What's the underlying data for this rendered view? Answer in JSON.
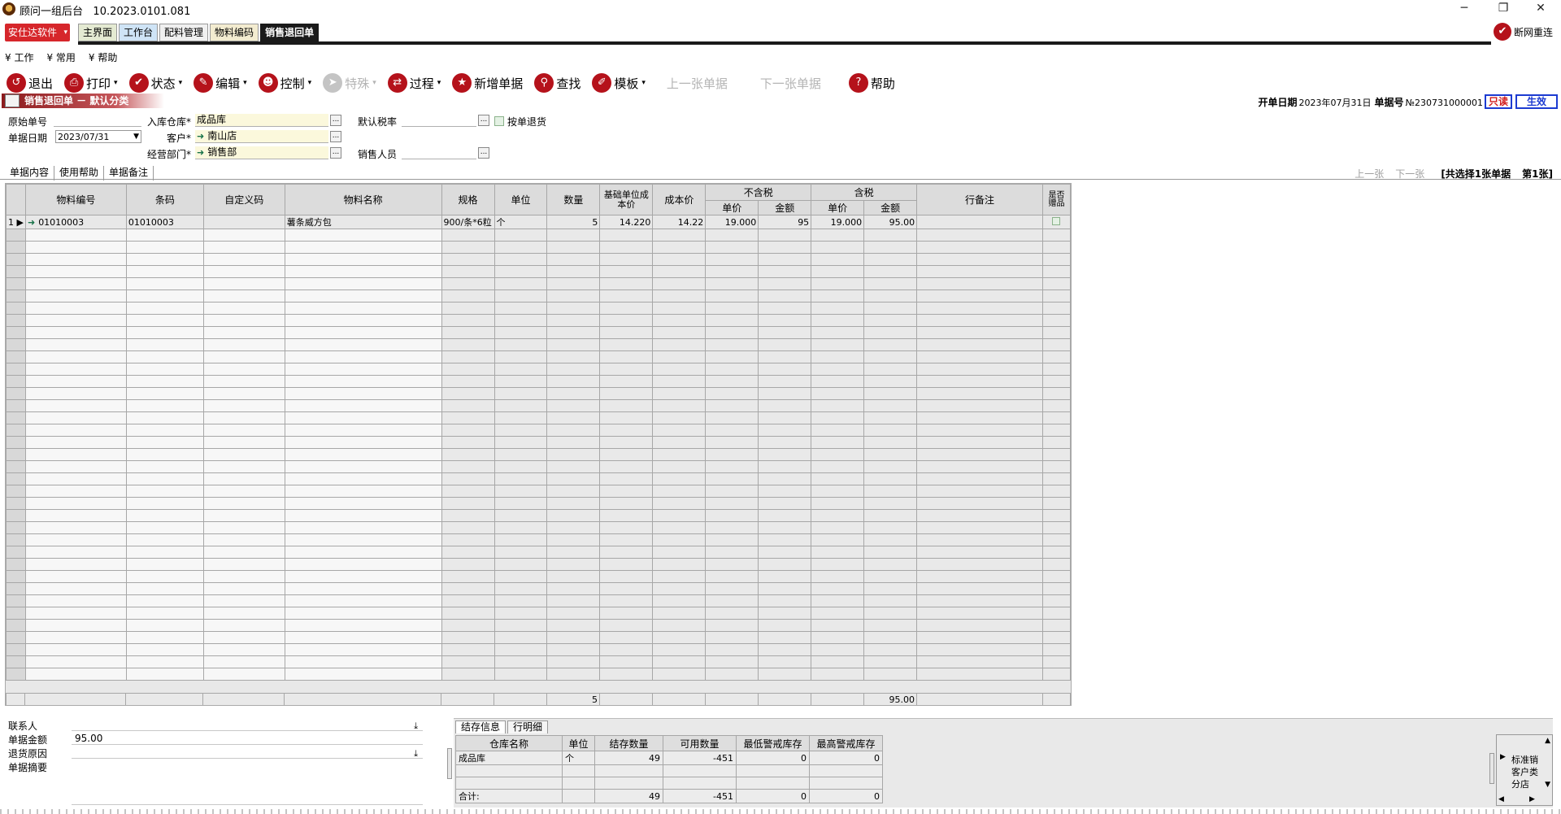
{
  "window": {
    "title": "顾问一组后台",
    "version": "10.2023.0101.081",
    "minimize": "─",
    "restore": "❐",
    "close": "✕"
  },
  "brand": {
    "label": "安仕达软件",
    "caret": "▾"
  },
  "nav_tabs": [
    "主界面",
    "工作台",
    "配料管理",
    "物料编码",
    "销售退回单"
  ],
  "offline": {
    "label": "断网重连"
  },
  "menu": [
    "¥ 工作",
    "¥ 常用",
    "¥ 帮助"
  ],
  "toolbar": [
    {
      "label": "退出",
      "icon": "exit-icon",
      "dropdown": false,
      "disabled": false
    },
    {
      "label": "打印",
      "icon": "print-icon",
      "dropdown": true,
      "disabled": false
    },
    {
      "label": "状态",
      "icon": "check-icon",
      "dropdown": true,
      "disabled": false
    },
    {
      "label": "编辑",
      "icon": "edit-icon",
      "dropdown": true,
      "disabled": false
    },
    {
      "label": "控制",
      "icon": "user-icon",
      "dropdown": true,
      "disabled": false
    },
    {
      "label": "特殊",
      "icon": "send-icon",
      "dropdown": true,
      "disabled": true
    },
    {
      "label": "过程",
      "icon": "process-icon",
      "dropdown": true,
      "disabled": false
    },
    {
      "label": "新增单据",
      "icon": "star-icon",
      "dropdown": false,
      "disabled": false
    },
    {
      "label": "查找",
      "icon": "search-icon",
      "dropdown": false,
      "disabled": false
    },
    {
      "label": "模板",
      "icon": "template-icon",
      "dropdown": true,
      "disabled": false
    },
    {
      "label": "上一张单据",
      "icon": "",
      "dropdown": false,
      "disabled": true
    },
    {
      "label": "下一张单据",
      "icon": "",
      "dropdown": false,
      "disabled": true
    },
    {
      "label": "帮助",
      "icon": "help-icon",
      "dropdown": false,
      "disabled": false
    }
  ],
  "form": {
    "title": "销售退回单 － 默认分类",
    "open_date_label": "开单日期",
    "open_date": "2023年07月31日",
    "doc_no_label": "单据号",
    "doc_no": "№230731000001",
    "badge_readonly": "只读",
    "badge_effective": "生效",
    "fields": {
      "orig_doc_label": "原始单号",
      "orig_doc_value": "",
      "doc_date_label": "单据日期",
      "doc_date_value": "2023/07/31",
      "warehouse_label": "入库仓库*",
      "warehouse_value": "成品库",
      "customer_label": "客户*",
      "customer_value": "南山店",
      "dept_label": "经营部门*",
      "dept_value": "销售部",
      "tax_label": "默认税率",
      "tax_value": "",
      "by_doc_return_label": "按单退货",
      "sales_person_label": "销售人员",
      "sales_person_value": ""
    }
  },
  "sub_tabs": [
    "单据内容",
    "使用帮助",
    "单据备注"
  ],
  "pager": {
    "prev": "上一张",
    "next": "下一张",
    "summary": "[共选择1张单据",
    "current": "第1张]"
  },
  "grid": {
    "headers": {
      "item_code": "物料编号",
      "barcode": "条码",
      "custom_code": "自定义码",
      "item_name": "物料名称",
      "spec": "规格",
      "unit": "单位",
      "qty": "数量",
      "base_cost": "基础单位成本价",
      "cost": "成本价",
      "no_tax": "不含税",
      "no_tax_price": "单价",
      "no_tax_amount": "金额",
      "tax": "含税",
      "tax_price": "单价",
      "tax_amount": "金额",
      "note": "行备注",
      "gift": "是否赠品"
    },
    "rows": [
      {
        "row_no": "1",
        "item_code": "01010003",
        "barcode": "01010003",
        "custom_code": "",
        "item_name": "薯条威方包",
        "spec": "900/条*6粒",
        "unit": "个",
        "qty": "5",
        "base_cost": "14.220",
        "cost": "14.22",
        "no_tax_price": "19.000",
        "no_tax_amount": "95",
        "tax_price": "19.000",
        "tax_amount": "95.00",
        "note": ""
      }
    ],
    "totals": {
      "qty": "5",
      "tax_amount": "95.00"
    }
  },
  "bottom": {
    "contact_label": "联系人",
    "contact_value": "",
    "amount_label": "单据金额",
    "amount_value": "95.00",
    "reason_label": "退货原因",
    "reason_value": "",
    "summary_label": "单据摘要",
    "summary_value": ""
  },
  "stock": {
    "tabs": [
      "结存信息",
      "行明细"
    ],
    "headers": [
      "仓库名称",
      "单位",
      "结存数量",
      "可用数量",
      "最低警戒库存",
      "最高警戒库存"
    ],
    "rows": [
      [
        "成品库",
        "个",
        "49",
        "-451",
        "0",
        "0"
      ]
    ],
    "total_label": "合计:",
    "totals": [
      "",
      "49",
      "-451",
      "0",
      "0"
    ]
  },
  "right_mini": [
    "标准销",
    "客户类",
    "分店"
  ]
}
